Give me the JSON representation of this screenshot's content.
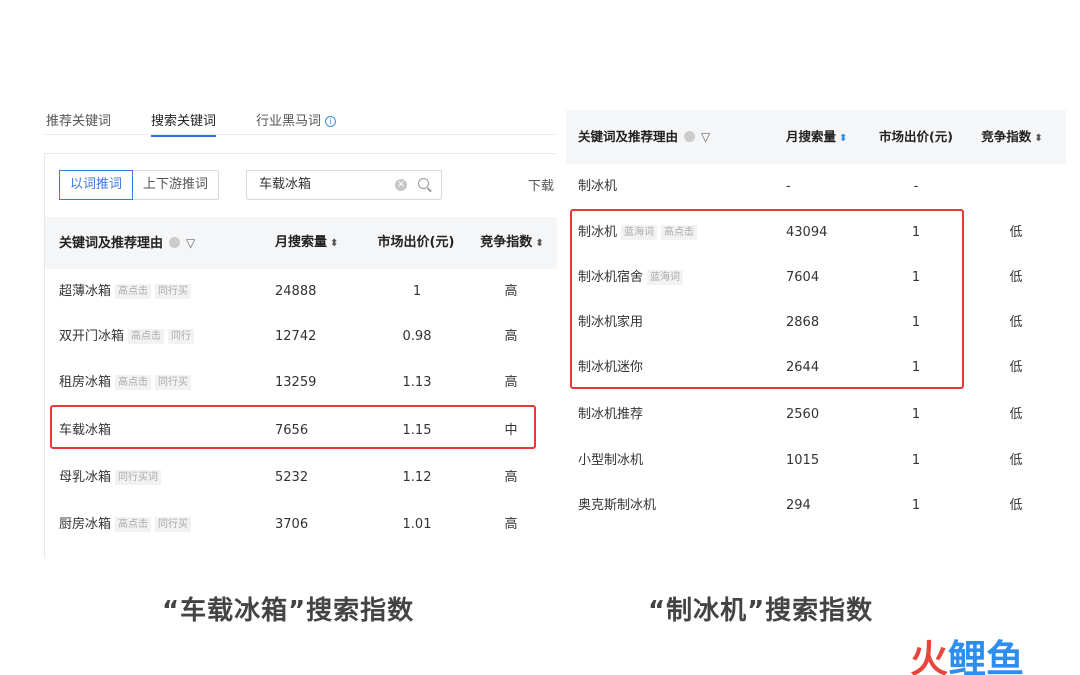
{
  "left_panel": {
    "tabs": [
      {
        "label": "推荐关键词",
        "active": false
      },
      {
        "label": "搜索关键词",
        "active": true
      },
      {
        "label": "行业黑马词",
        "active": false
      }
    ],
    "toggle": {
      "options": [
        "以词推词",
        "上下游推词"
      ],
      "selected": "以词推词"
    },
    "search": {
      "value": "车载冰箱"
    },
    "download_label": "下载",
    "columns": {
      "keyword": "关键词及推荐理由",
      "volume": "月搜索量",
      "price": "市场出价(元)",
      "competition": "竞争指数"
    },
    "rows": [
      {
        "keyword": "超薄冰箱",
        "tags": [
          "高点击",
          "同行买"
        ],
        "volume": "24888",
        "price": "1",
        "competition": "高"
      },
      {
        "keyword": "双开门冰箱",
        "tags": [
          "高点击",
          "同行"
        ],
        "volume": "12742",
        "price": "0.98",
        "competition": "高"
      },
      {
        "keyword": "租房冰箱",
        "tags": [
          "高点击",
          "同行买"
        ],
        "volume": "13259",
        "price": "1.13",
        "competition": "高"
      },
      {
        "keyword": "车载冰箱",
        "tags": [],
        "volume": "7656",
        "price": "1.15",
        "competition": "中"
      },
      {
        "keyword": "母乳冰箱",
        "tags": [
          "同行买词"
        ],
        "volume": "5232",
        "price": "1.12",
        "competition": "高"
      },
      {
        "keyword": "厨房冰箱",
        "tags": [
          "高点击",
          "同行买"
        ],
        "volume": "3706",
        "price": "1.01",
        "competition": "高"
      }
    ],
    "caption": "“车载冰箱”搜索指数"
  },
  "right_panel": {
    "columns": {
      "keyword": "关键词及推荐理由",
      "volume": "月搜索量",
      "price": "市场出价(元)",
      "competition": "竞争指数"
    },
    "rows": [
      {
        "keyword": "制冰机",
        "tags": [],
        "volume": "-",
        "price": "-",
        "competition": ""
      },
      {
        "keyword": "制冰机",
        "tags": [
          "蓝海词",
          "高点击"
        ],
        "volume": "43094",
        "price": "1",
        "competition": "低"
      },
      {
        "keyword": "制冰机宿舍",
        "tags": [
          "蓝海词"
        ],
        "volume": "7604",
        "price": "1",
        "competition": "低"
      },
      {
        "keyword": "制冰机家用",
        "tags": [],
        "volume": "2868",
        "price": "1",
        "competition": "低"
      },
      {
        "keyword": "制冰机迷你",
        "tags": [],
        "volume": "2644",
        "price": "1",
        "competition": "低"
      },
      {
        "keyword": "制冰机推荐",
        "tags": [],
        "volume": "2560",
        "price": "1",
        "competition": "低"
      },
      {
        "keyword": "小型制冰机",
        "tags": [],
        "volume": "1015",
        "price": "1",
        "competition": "低"
      },
      {
        "keyword": "奥克斯制冰机",
        "tags": [],
        "volume": "294",
        "price": "1",
        "competition": "低"
      }
    ],
    "caption": "“制冰机”搜索指数"
  },
  "logo": {
    "part1": "火",
    "part2": "鲤鱼"
  },
  "colors": {
    "highlight": "#e53935",
    "accent": "#2f6fe4",
    "logo_red": "#e8453c",
    "logo_blue": "#2d8ef0"
  }
}
